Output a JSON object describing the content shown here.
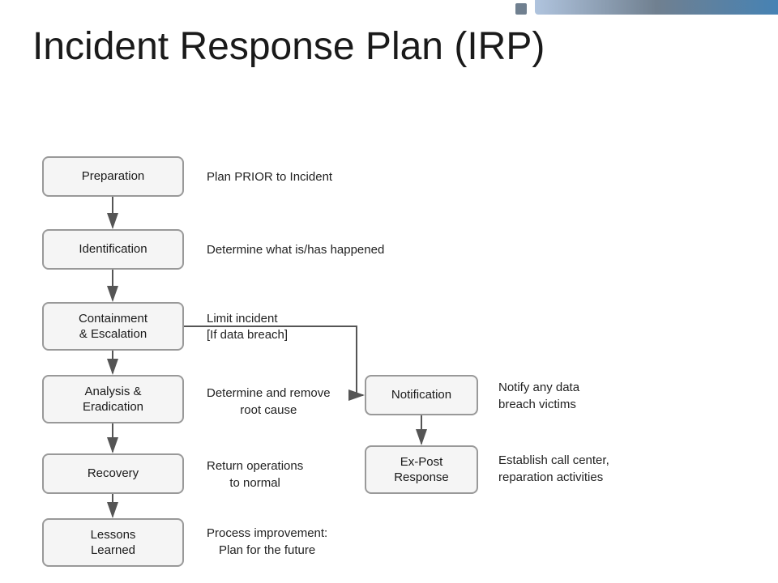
{
  "page": {
    "title": "Incident Response Plan (IRP)",
    "topbar": {}
  },
  "boxes": {
    "preparation": {
      "label": "Preparation"
    },
    "identification": {
      "label": "Identification"
    },
    "containment": {
      "label": "Containment\n& Escalation"
    },
    "analysis": {
      "label": "Analysis &\nEradication"
    },
    "recovery": {
      "label": "Recovery"
    },
    "lessons": {
      "label": "Lessons\nLearned"
    },
    "notification": {
      "label": "Notification"
    },
    "expost": {
      "label": "Ex-Post\nResponse"
    }
  },
  "descriptions": {
    "preparation": "Plan PRIOR to Incident",
    "identification": "Determine what is/has happened",
    "containment_line1": "Limit incident",
    "containment_line2": "[If data breach]",
    "analysis": "Determine and remove\nroot cause",
    "recovery": "Return operations\nto normal",
    "lessons": "Process improvement:\nPlan for the future",
    "notification": "Notify any data\nbreach victims",
    "expost": "Establish call center,\nreparation activities"
  }
}
